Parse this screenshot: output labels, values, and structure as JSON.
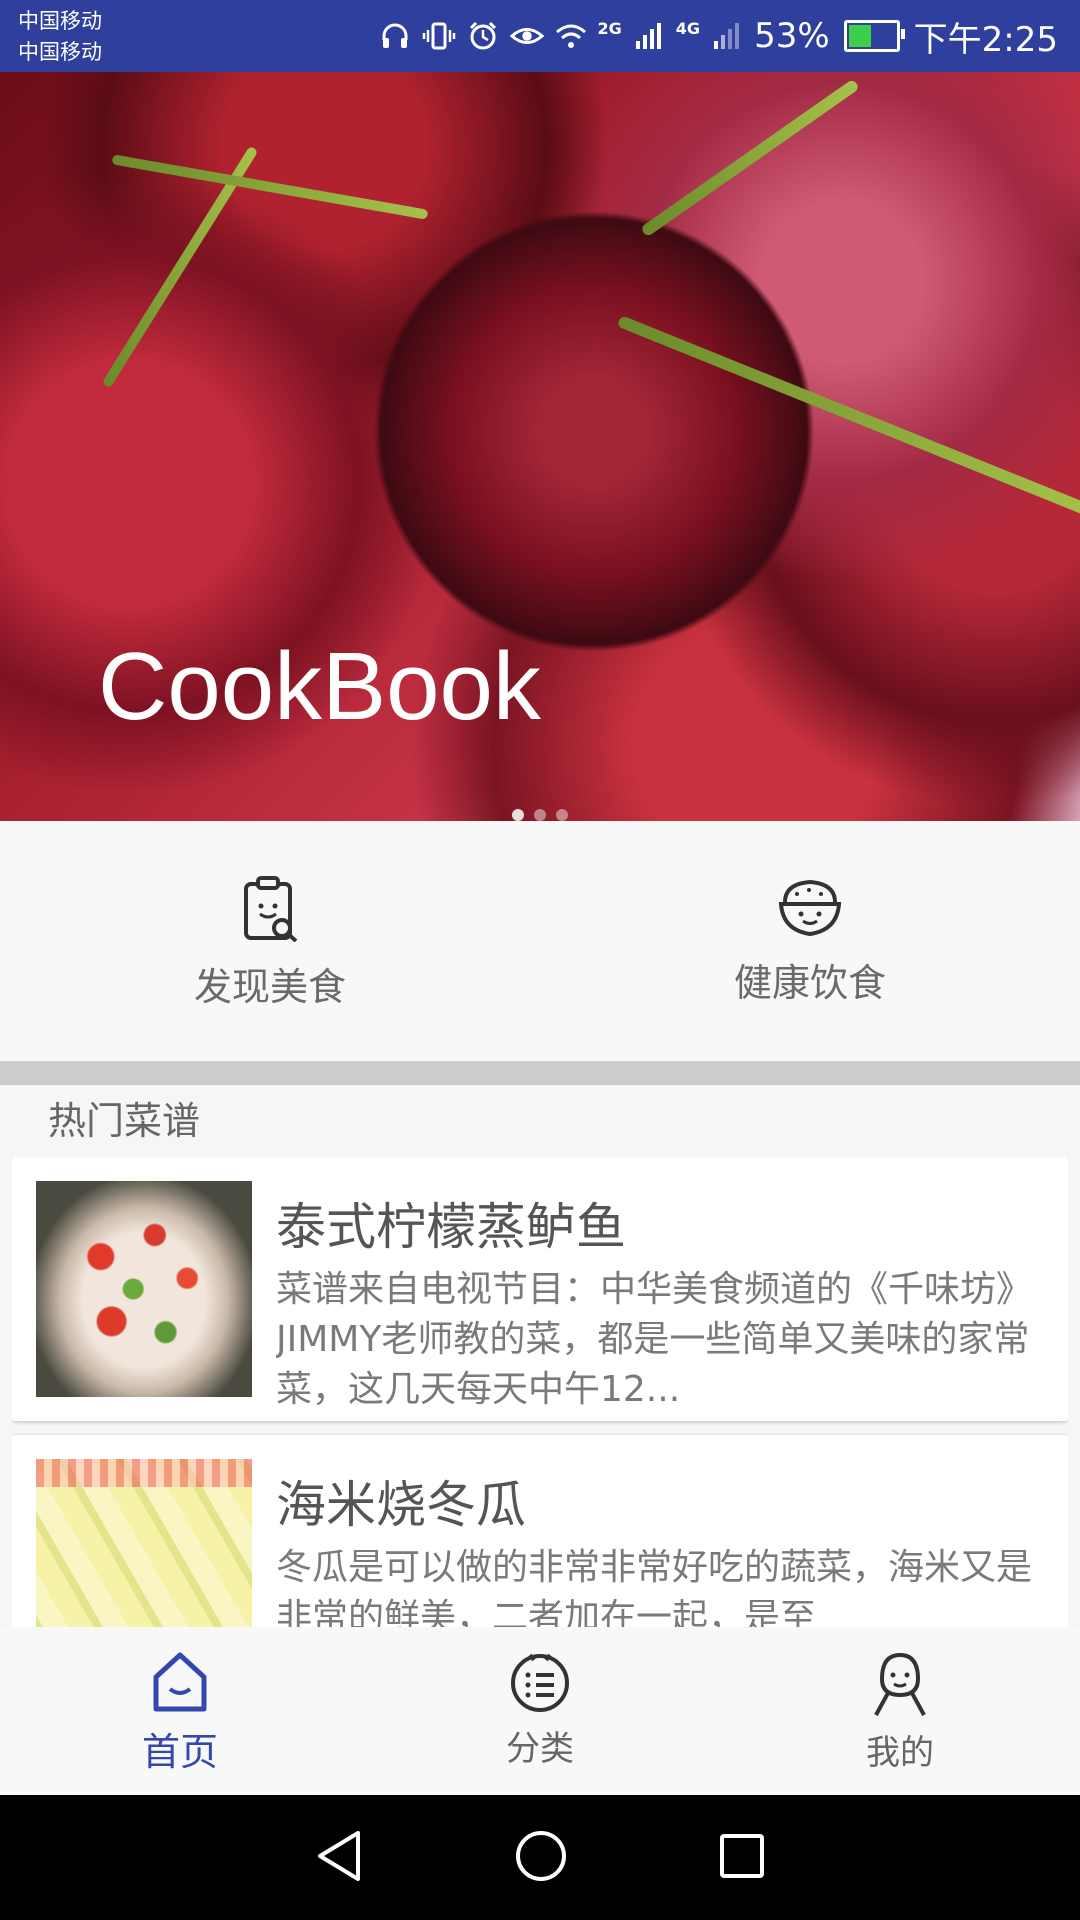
{
  "status_bar": {
    "carrier_1": "中国移动",
    "carrier_2": "中国移动",
    "net_2g": "2G",
    "net_4g": "4G",
    "battery_percent": "53%",
    "battery_level": 0.53,
    "time": "下午2:25",
    "icons": [
      "headphones-icon",
      "vibrate-icon",
      "alarm-icon",
      "eye-icon",
      "wifi-icon",
      "signal-icon",
      "battery-icon"
    ]
  },
  "banner": {
    "title": "CookBook",
    "slide_count": 3,
    "active_slide": 0
  },
  "features": [
    {
      "label": "发现美食",
      "icon": "clipboard-search-icon"
    },
    {
      "label": "健康饮食",
      "icon": "rice-bowl-icon"
    }
  ],
  "section": {
    "title": "热门菜谱"
  },
  "recipes": [
    {
      "title": "泰式柠檬蒸鲈鱼",
      "description": "菜谱来自电视节目：中华美食频道的《千味坊》JIMMY老师教的菜，都是一些简单又美味的家常菜，这几天每天中午12..."
    },
    {
      "title": "海米烧冬瓜",
      "description": "冬瓜是可以做的非常非常好吃的蔬菜，海米又是非常的鲜美，二者加在一起，是至"
    }
  ],
  "bottom_nav": [
    {
      "label": "首页",
      "icon": "home-icon",
      "active": true
    },
    {
      "label": "分类",
      "icon": "category-icon",
      "active": false
    },
    {
      "label": "我的",
      "icon": "profile-icon",
      "active": false
    }
  ],
  "colors": {
    "status_bar": "#2f3f9e",
    "accent": "#3446b0",
    "text_gray": "#666666"
  }
}
